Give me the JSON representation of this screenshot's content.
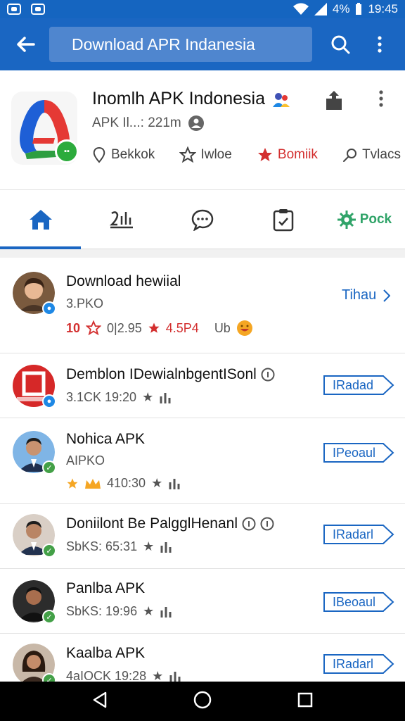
{
  "status_bar": {
    "battery_pct": "4%",
    "time": "19:45"
  },
  "toolbar": {
    "search_text": "Download APR Indanesia"
  },
  "app": {
    "title": "Inomlh APK Indonesia",
    "subtitle": "APK Il...: 221m",
    "actions": [
      {
        "label": "Bekkok",
        "icon": "location-icon"
      },
      {
        "label": "Iwloe",
        "icon": "star-outline-icon"
      },
      {
        "label": "Bomiik",
        "icon": "star-filled-icon"
      },
      {
        "label": "Tvlacs",
        "icon": "search-icon"
      }
    ]
  },
  "tabs": [
    {
      "label": "",
      "icon": "home-icon",
      "active": true
    },
    {
      "label": "",
      "icon": "chart-icon"
    },
    {
      "label": "",
      "icon": "chat-icon"
    },
    {
      "label": "",
      "icon": "clipboard-icon"
    },
    {
      "label": "Pock",
      "icon": "gear-icon"
    }
  ],
  "items": [
    {
      "title": "Download hewiial",
      "meta": "3.PKO",
      "meta2_a": "10",
      "meta2_b": "0|2.95",
      "meta2_c": "4.5P4",
      "meta2_d": "Ub",
      "link": "Tihau"
    },
    {
      "title": "Demblon IDewialnbgentISonl",
      "meta": "3.1CK 19:20",
      "button": "IRadad"
    },
    {
      "title": "Nohica APK",
      "meta": "AIPKO",
      "meta2": "410:30",
      "button": "IPeoaul"
    },
    {
      "title": "Doniilont Be PalgglHenanl",
      "meta": "SbKS: 65:31",
      "button": "IRadarl"
    },
    {
      "title": "Panlba APK",
      "meta": "SbKS: 19:96",
      "button": "IBeoaul"
    },
    {
      "title": "Kaalba APK",
      "meta": "4aIOCK 19:28",
      "button": "IRadarl"
    }
  ],
  "colors": {
    "primary": "#1a66c2",
    "accent_green": "#2fa368",
    "accent_red": "#d32f2f"
  }
}
